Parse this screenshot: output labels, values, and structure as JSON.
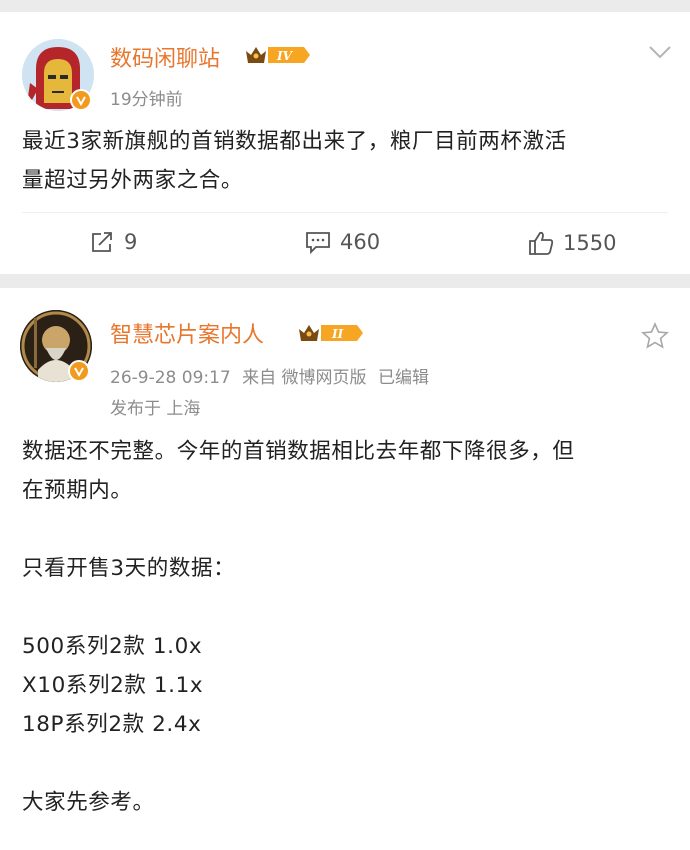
{
  "post1": {
    "username": "数码闲聊站",
    "level": "IV",
    "time": "19分钟前",
    "text_lines": [
      "最近3家新旗舰的首销数据都出来了，粮厂目前两杯激活",
      "量超过另外两家之合。"
    ],
    "actions": {
      "repost": "9",
      "comment": "460",
      "like": "1550"
    }
  },
  "post2": {
    "username": "智慧芯片案内人",
    "level": "II",
    "time": "26-9-28 09:17",
    "source": "来自 微博网页版",
    "edited": "已编辑",
    "location": "发布于 上海",
    "text": {
      "line1": "数据还不完整。今年的首销数据相比去年都下降很多，但",
      "line2": "在预期内。",
      "line3": "只看开售3天的数据：",
      "line4": "500系列2款  1.0x",
      "line5": "X10系列2款  1.1x",
      "line6": "18P系列2款  2.4x",
      "line7": "大家先参考。"
    }
  },
  "colors": {
    "username": "#e8772e",
    "verified": "#f29a1d",
    "meta": "#8c8c8c",
    "background": "#ebebeb"
  }
}
